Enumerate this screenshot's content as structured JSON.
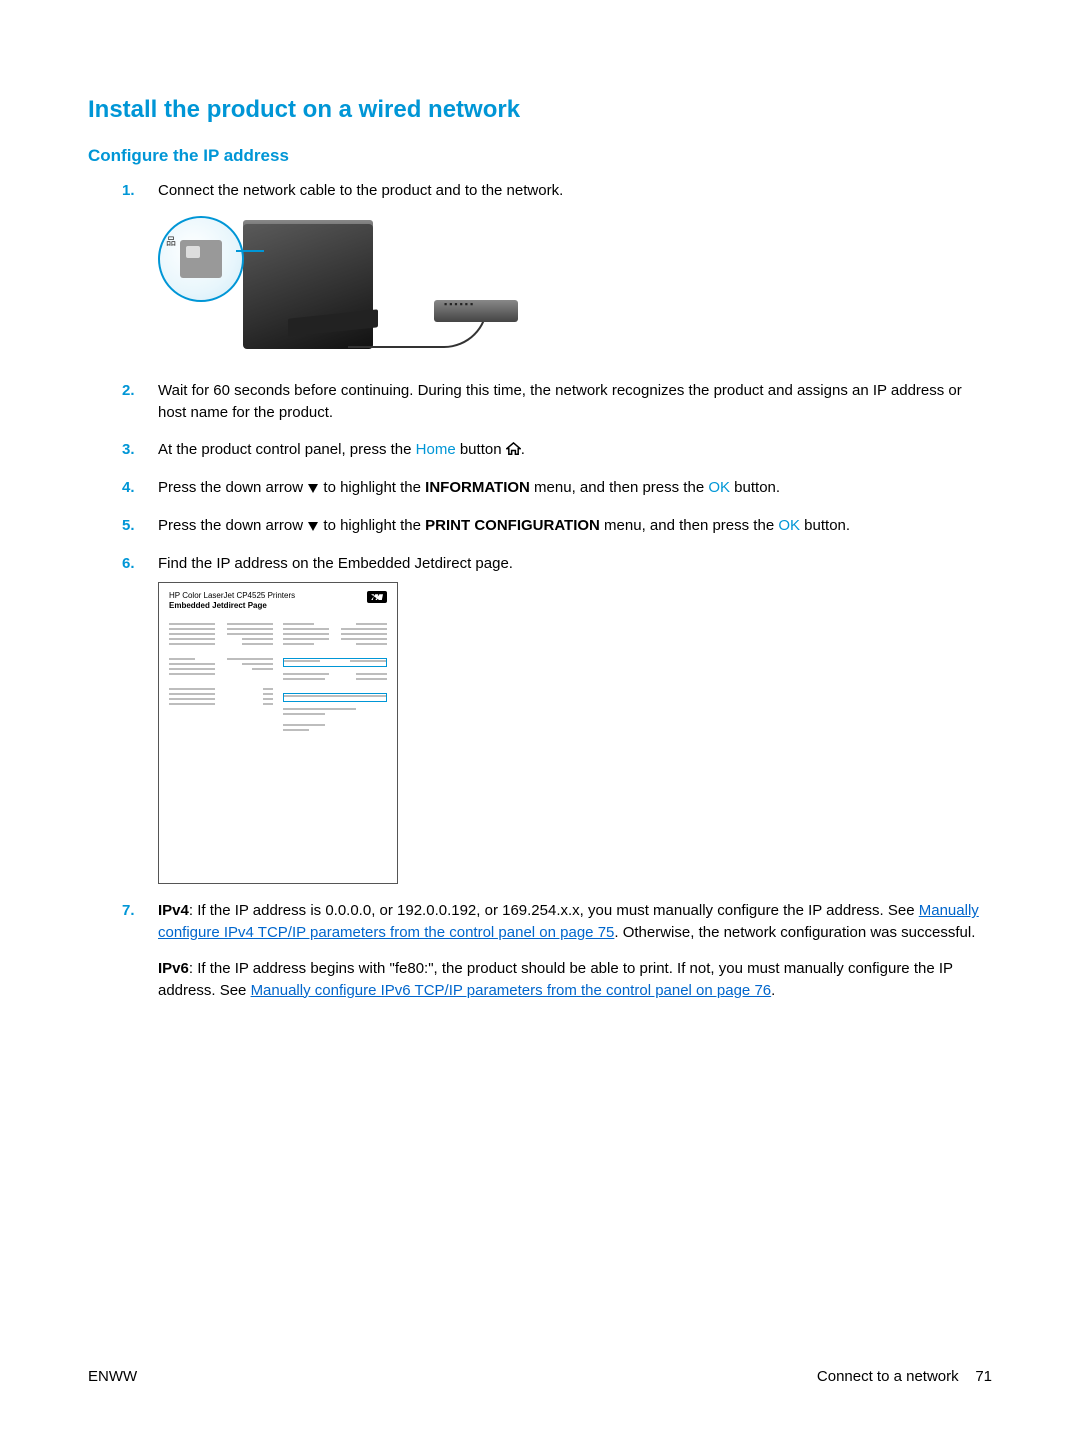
{
  "headings": {
    "main": "Install the product on a wired network",
    "sub": "Configure the IP address"
  },
  "steps": {
    "n1": "1.",
    "s1": "Connect the network cable to the product and to the network.",
    "n2": "2.",
    "s2": "Wait for 60 seconds before continuing. During this time, the network recognizes the product and assigns an IP address or host name for the product.",
    "n3": "3.",
    "s3a": "At the product control panel, press the ",
    "s3_home": "Home",
    "s3b": " button ",
    "s3c": ".",
    "n4": "4.",
    "s4a": "Press the down arrow ",
    "s4b": " to highlight the ",
    "s4_menu": "INFORMATION",
    "s4c": " menu, and then press the ",
    "s4_ok": "OK",
    "s4d": " button.",
    "n5": "5.",
    "s5a": "Press the down arrow ",
    "s5b": " to highlight the ",
    "s5_menu": "PRINT CONFIGURATION",
    "s5c": " menu, and then press the ",
    "s5_ok": "OK",
    "s5d": " button.",
    "n6": "6.",
    "s6": "Find the IP address on the Embedded Jetdirect page.",
    "n7": "7.",
    "s7_ipv4_label": "IPv4",
    "s7_ipv4_a": ": If the IP address is 0.0.0.0, or 192.0.0.192, or 169.254.x.x, you must manually configure the IP address. See ",
    "s7_ipv4_link": "Manually configure IPv4 TCP/IP parameters from the control panel on page 75",
    "s7_ipv4_b": ". Otherwise, the network configuration was successful.",
    "s7_ipv6_label": "IPv6",
    "s7_ipv6_a": ": If the IP address begins with \"fe80:\", the product should be able to print. If not, you must manually configure the IP address. See ",
    "s7_ipv6_link": "Manually configure IPv6 TCP/IP parameters from the control panel on page 76",
    "s7_ipv6_b": "."
  },
  "jetdirect": {
    "line1": "HP Color LaserJet CP4525 Printers",
    "line2": "Embedded Jetdirect Page"
  },
  "footer": {
    "left": "ENWW",
    "right_label": "Connect to a network",
    "page": "71"
  }
}
